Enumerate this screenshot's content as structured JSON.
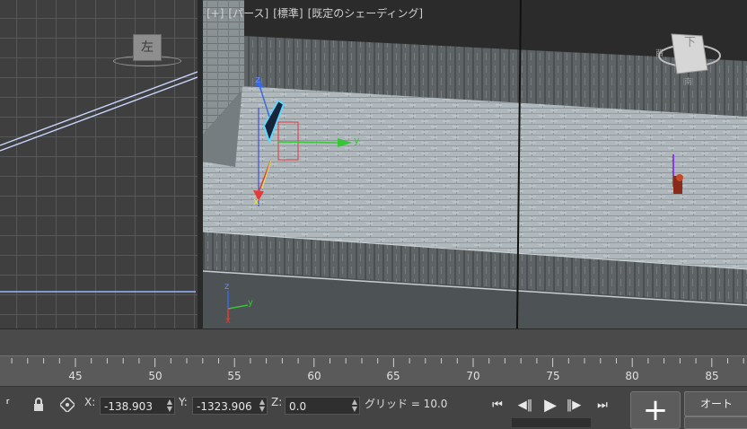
{
  "left_viewport": {
    "viewcube_label": "左"
  },
  "right_viewport": {
    "label_parts": [
      "[+]",
      "[パース]",
      "[標準]",
      "[既定のシェーディング]"
    ],
    "viewcube_label": "下",
    "compass_labels": [
      "西",
      "南"
    ],
    "gizmo_axes": [
      "x",
      "y",
      "z"
    ],
    "world_axes": [
      "x",
      "y",
      "z"
    ]
  },
  "timeline": {
    "ticks": [
      "45",
      "50",
      "55",
      "60",
      "65",
      "70",
      "75",
      "80",
      "85"
    ]
  },
  "statusbar": {
    "x_label": "X:",
    "x_value": "-138.903",
    "y_label": "Y:",
    "y_value": "-1323.906",
    "z_label": "Z:",
    "z_value": "0.0",
    "grid_label": "グリッド = 10.0"
  },
  "playback": {
    "auto_key_label": "オート"
  },
  "colors": {
    "x_axis": "#e33a3a",
    "y_axis": "#39c439",
    "z_axis": "#3a6ae3",
    "selection": "#5fd7ff"
  }
}
